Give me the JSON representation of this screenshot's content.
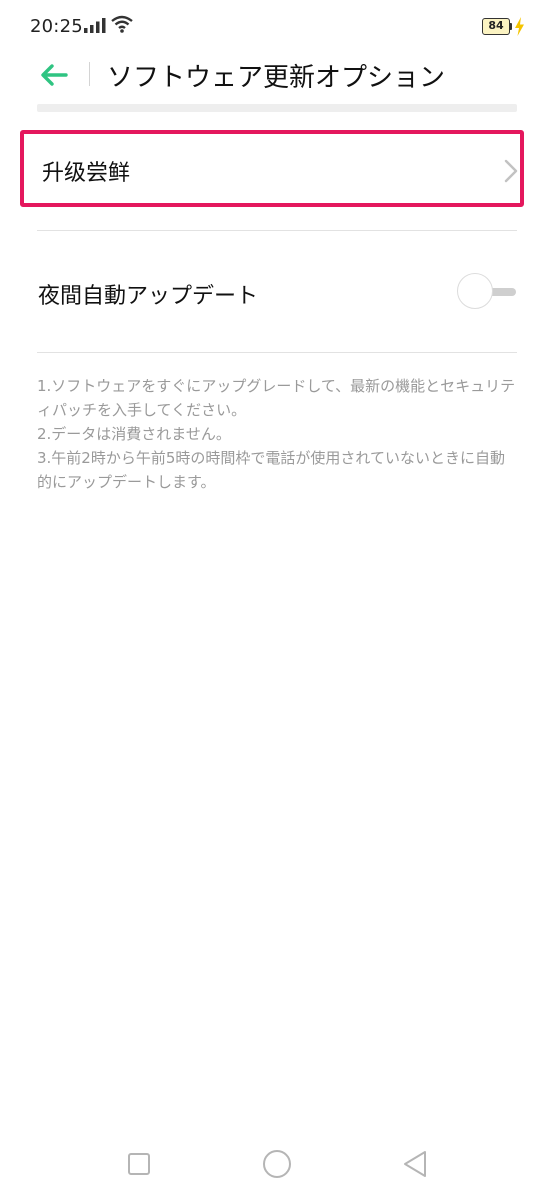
{
  "status_bar": {
    "time": "20:25",
    "battery_level": "84",
    "icons": [
      "signal-icon",
      "wifi-icon",
      "battery-icon",
      "charging-bolt-icon"
    ]
  },
  "header": {
    "title": "ソフトウェア更新オプション",
    "back_icon": "arrow-left-icon"
  },
  "menu": {
    "upgrade_label": "升级尝鲜",
    "night_update_label": "夜間自動アップデート",
    "night_update_enabled": false
  },
  "notes": [
    "1.ソフトウェアをすぐにアップグレードして、最新の機能とセキュリティパッチを入手してください。",
    "2.データは消費されません。",
    "3.午前2時から午前5時の時間枠で電話が使用されていないときに自動的にアップデートします。"
  ],
  "nav_bar": {
    "buttons": [
      "recents-square-icon",
      "home-circle-icon",
      "back-triangle-icon"
    ]
  },
  "colors": {
    "accent": "#2fc482",
    "highlight_border": "#e4175d",
    "note_text": "#9a9a9a"
  }
}
